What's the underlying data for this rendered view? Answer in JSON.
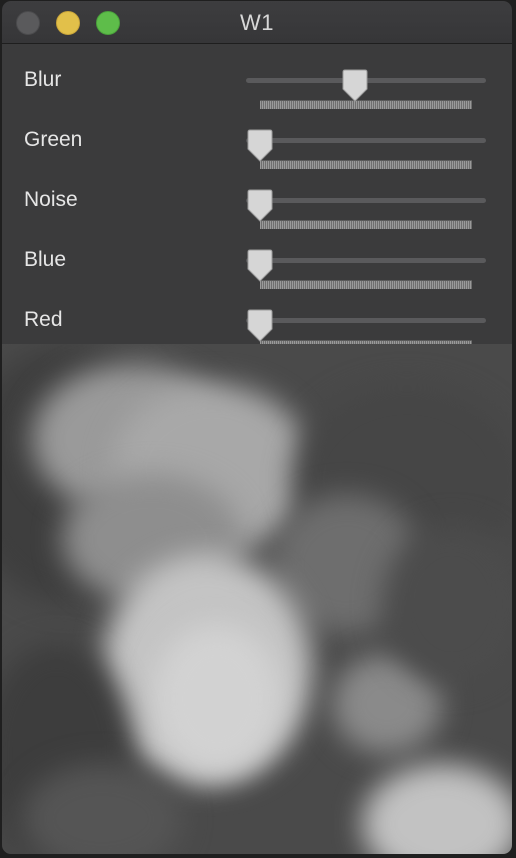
{
  "window": {
    "title": "W1"
  },
  "sliders": [
    {
      "label": "Blur",
      "value": 0.46
    },
    {
      "label": "Green",
      "value": 0.0
    },
    {
      "label": "Noise",
      "value": 0.0
    },
    {
      "label": "Blue",
      "value": 0.0
    },
    {
      "label": "Red",
      "value": 0.0
    }
  ]
}
